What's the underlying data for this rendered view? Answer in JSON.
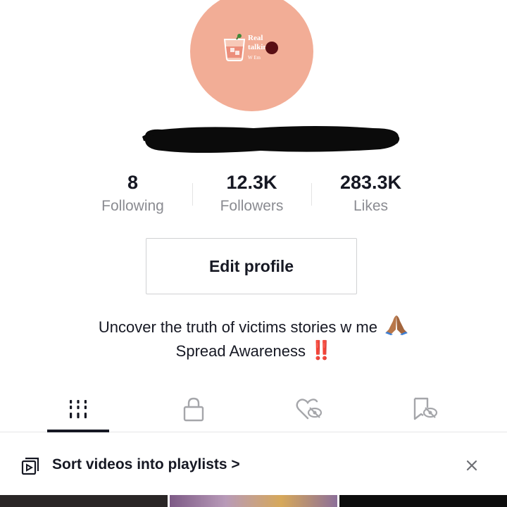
{
  "profile": {
    "avatar_text_line1": "Real",
    "avatar_text_line2": "talkin",
    "avatar_text_sub": "W Em",
    "avatar_bg": "#f2ad96"
  },
  "stats": [
    {
      "value": "8",
      "label": "Following"
    },
    {
      "value": "12.3K",
      "label": "Followers"
    },
    {
      "value": "283.3K",
      "label": "Likes"
    }
  ],
  "edit_button_label": "Edit profile",
  "bio": {
    "line1": "Uncover the truth of victims stories w me",
    "line1_emoji": "folded-hands-emoji",
    "line2": "Spread Awareness",
    "line2_emoji": "‼️"
  },
  "tabs": [
    {
      "icon": "videos-grid-icon",
      "active": true
    },
    {
      "icon": "lock-icon",
      "active": false
    },
    {
      "icon": "liked-hidden-icon",
      "active": false
    },
    {
      "icon": "saved-hidden-icon",
      "active": false
    }
  ],
  "banner": {
    "icon": "playlist-icon",
    "text": "Sort videos into playlists >",
    "close_icon": "close-icon"
  },
  "colors": {
    "text": "#161823",
    "secondary": "#8a8b91",
    "accent_red": "#e02020"
  }
}
